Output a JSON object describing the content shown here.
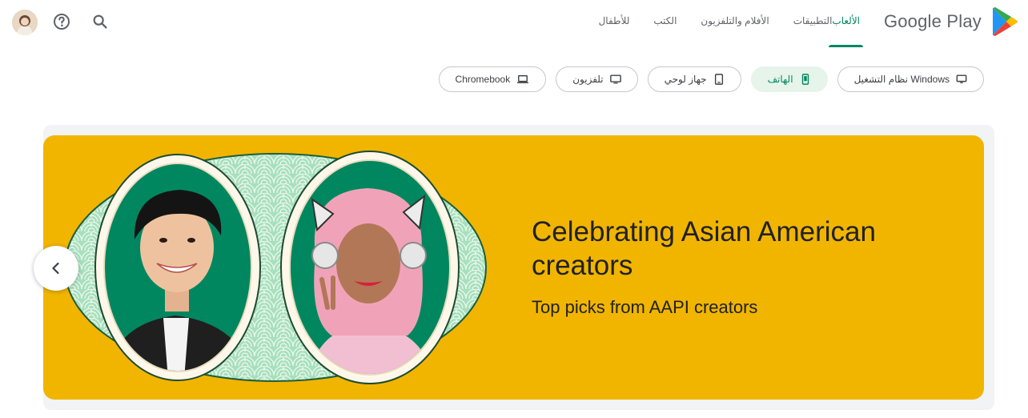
{
  "header": {
    "brand": "Google Play",
    "nav": [
      {
        "label": "الألعاب",
        "active": true
      },
      {
        "label": "التطبيقات",
        "active": false
      },
      {
        "label": "الأفلام والتلفزيون",
        "active": false
      },
      {
        "label": "الكتب",
        "active": false
      },
      {
        "label": "للأطفال",
        "active": false
      }
    ],
    "icons": [
      "search-icon",
      "help-icon",
      "avatar"
    ]
  },
  "device_chips": [
    {
      "label": "نظام التشغيل Windows",
      "icon": "desktop-icon",
      "active": false
    },
    {
      "label": "الهاتف",
      "icon": "phone-icon",
      "active": true
    },
    {
      "label": "جهاز لوحي",
      "icon": "tablet-icon",
      "active": false
    },
    {
      "label": "تلفزيون",
      "icon": "tv-icon",
      "active": false
    },
    {
      "label": "Chromebook",
      "icon": "laptop-icon",
      "active": false
    }
  ],
  "banner": {
    "title": "Celebrating Asian American creators",
    "subtitle": "Top picks from AAPI creators",
    "background": "#f1b500"
  },
  "colors": {
    "accent": "#01875f",
    "chip_active_bg": "#e6f4ea",
    "banner_bg": "#f1b500",
    "oval_fill": "#9fdcb5",
    "portrait_bg": "#01875f"
  }
}
